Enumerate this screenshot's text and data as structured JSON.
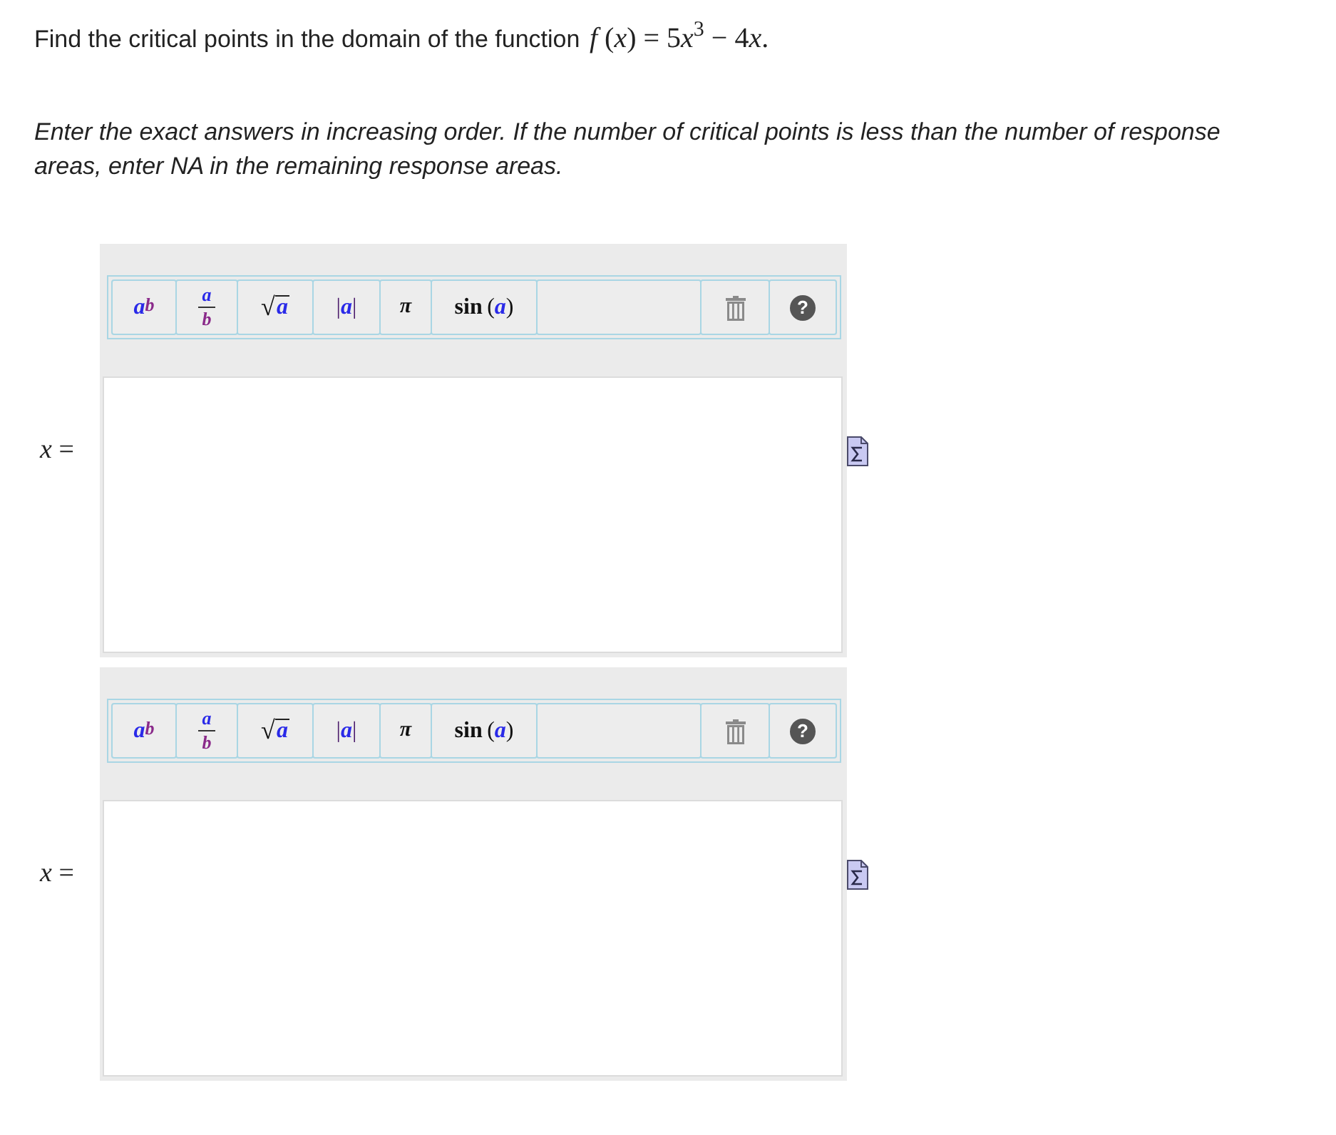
{
  "question": {
    "text": "Find the critical points in the domain of the function",
    "formula": [
      {
        "kind": "variable",
        "text": "f"
      },
      {
        "kind": "operator",
        "text": " ("
      },
      {
        "kind": "variable",
        "text": "x"
      },
      {
        "kind": "operator",
        "text": ") = 5"
      },
      {
        "kind": "variable",
        "text": "x"
      },
      {
        "kind": "exponent",
        "text": "3"
      },
      {
        "kind": "operator",
        "text": " − 4"
      },
      {
        "kind": "variable",
        "text": "x"
      },
      {
        "kind": "operator",
        "text": "."
      }
    ]
  },
  "instructions": "Enter the exact answers in increasing order. If the number of critical points is less than the number of response areas, enter NA in the remaining response areas.",
  "answers": [
    {
      "label": "*x* =",
      "toolbar": [
        {
          "kind": "power",
          "base": "a",
          "exponent": "b"
        },
        {
          "kind": "fraction",
          "numerator": "a",
          "denominator": "b"
        },
        {
          "kind": "root",
          "symbol": "√",
          "radicand": "a"
        },
        {
          "kind": "enclosed",
          "open": "|",
          "arg": "a",
          "close": "|"
        },
        {
          "kind": "symbol",
          "label": "π"
        },
        {
          "kind": "function",
          "name": "sin",
          "open": "(",
          "arg": "a",
          "close": ")"
        },
        {
          "kind": "spacer"
        },
        {
          "kind": "delete"
        },
        {
          "kind": "help",
          "label": "?"
        }
      ]
    },
    {
      "label": "*x* =",
      "toolbar": [
        {
          "kind": "power",
          "base": "a",
          "exponent": "b"
        },
        {
          "kind": "fraction",
          "numerator": "a",
          "denominator": "b"
        },
        {
          "kind": "root",
          "symbol": "√",
          "radicand": "a"
        },
        {
          "kind": "enclosed",
          "open": "|",
          "arg": "a",
          "close": "|"
        },
        {
          "kind": "symbol",
          "label": "π"
        },
        {
          "kind": "function",
          "name": "sin",
          "open": "(",
          "arg": "a",
          "close": ")"
        },
        {
          "kind": "spacer"
        },
        {
          "kind": "delete"
        },
        {
          "kind": "help",
          "label": "?"
        }
      ]
    }
  ]
}
